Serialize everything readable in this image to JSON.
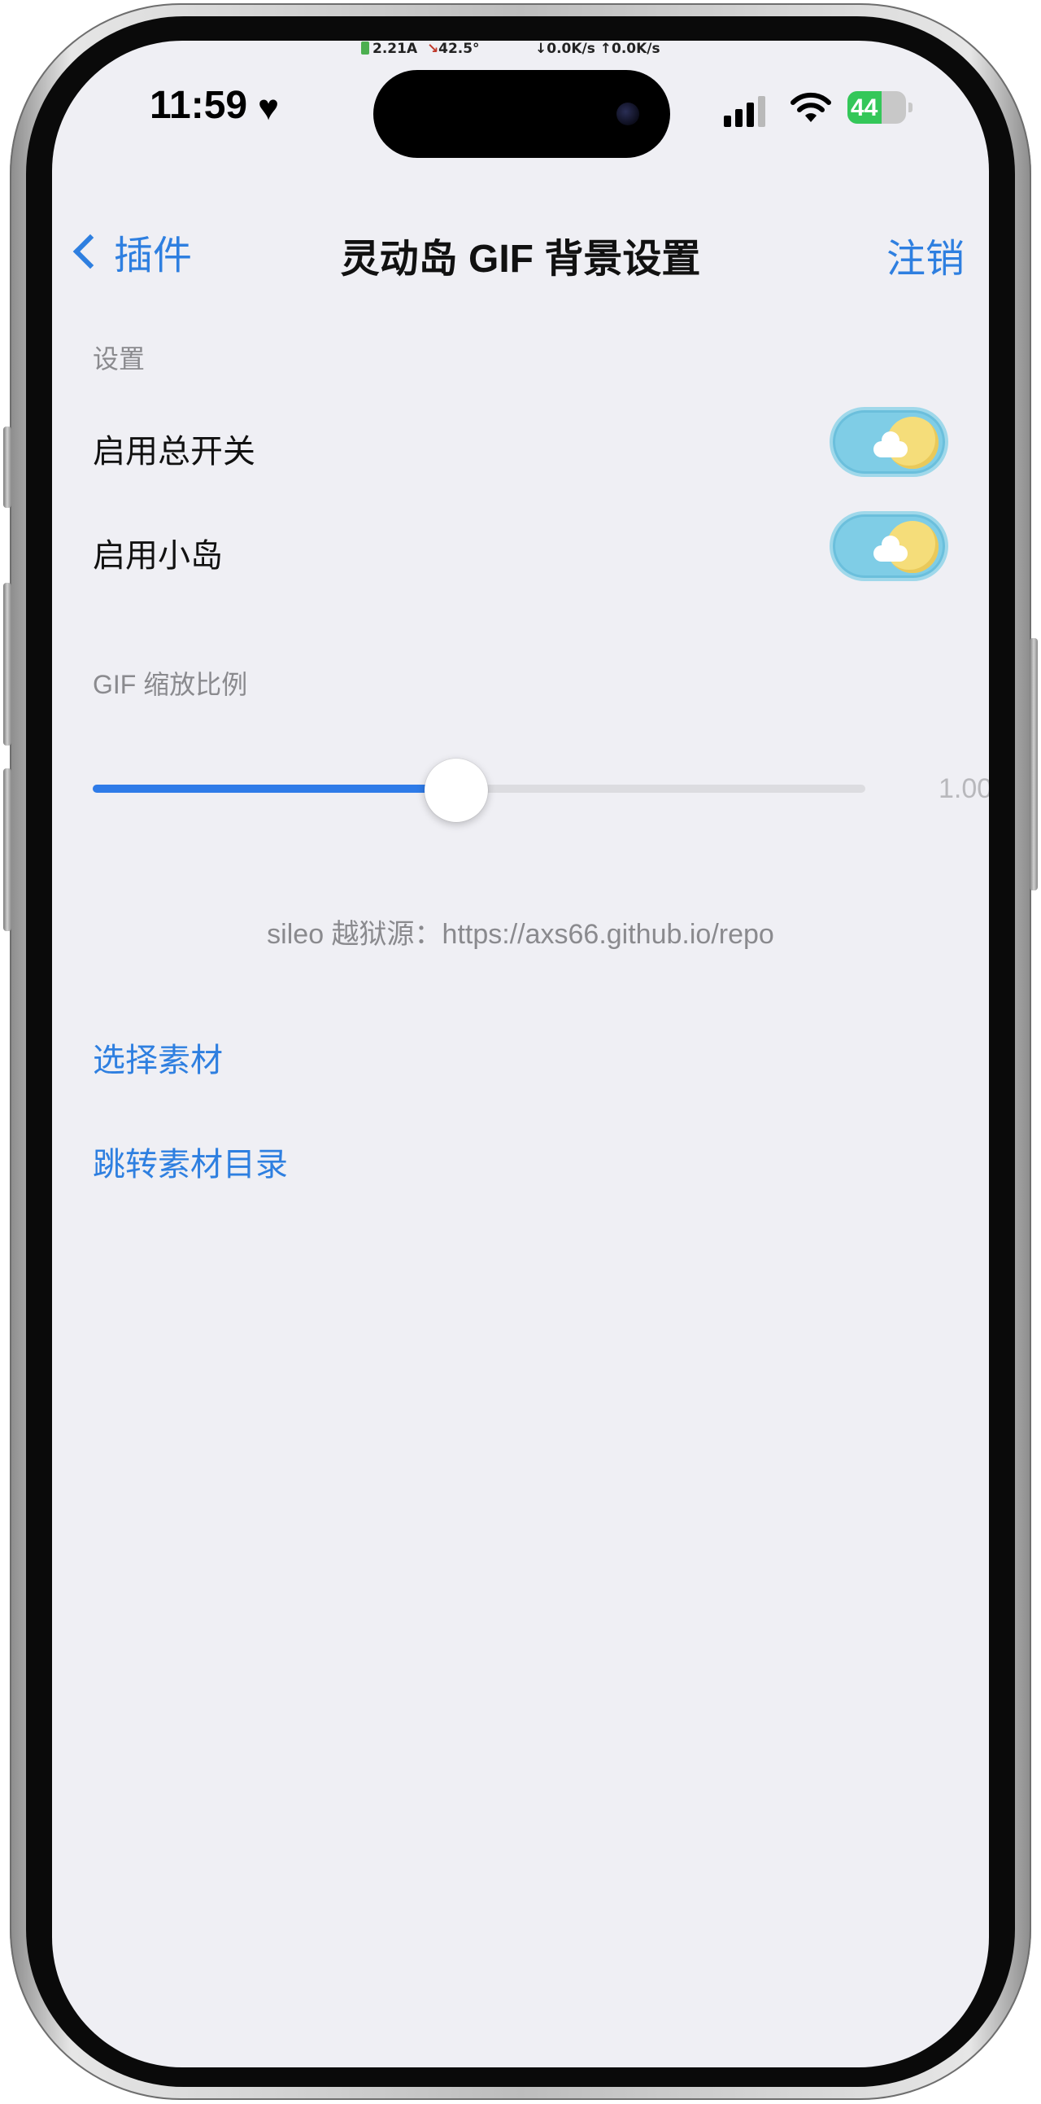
{
  "status_bar": {
    "current": "2.21A",
    "temperature": "42.5°",
    "network_speed": "↓0.0K/s ↑0.0K/s",
    "time": "11:59",
    "heart": "♥",
    "battery": "44"
  },
  "navbar": {
    "back_label": "插件",
    "title": "灵动岛 GIF 背景设置",
    "right_label": "注销"
  },
  "settings": {
    "header": "设置",
    "items": [
      {
        "label": "启用总开关",
        "enabled": true
      },
      {
        "label": "启用小岛",
        "enabled": true
      }
    ]
  },
  "gif_scale": {
    "header": "GIF 缩放比例",
    "value_text": "1.00",
    "position": 0.47
  },
  "credit": "sileo 越狱源：https://axs66.github.io/repo",
  "links": {
    "select_material": "选择素材",
    "open_material_dir": "跳转素材目录"
  },
  "colors": {
    "accent": "#2e7fe0",
    "background": "#efeff4",
    "slider_fill": "#2e7be8",
    "toggle_bg": "#7fcde6",
    "toggle_sun": "#f5dd7a"
  }
}
